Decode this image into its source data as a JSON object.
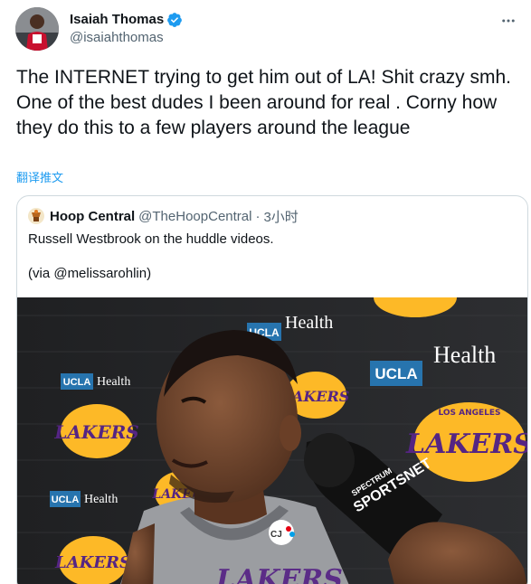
{
  "tweet": {
    "author": {
      "display_name": "Isaiah Thomas",
      "handle": "@isaiahthomas",
      "verified": true
    },
    "more_icon": "more-dots-icon",
    "text": "The INTERNET trying to get him out of LA! Shit crazy smh. One of the best dudes I been around for real . Corny how they do this to a few players around the league",
    "translate_label": "翻译推文"
  },
  "quoted_tweet": {
    "author": {
      "display_name": "Hoop Central",
      "handle": "@TheHoopCentral",
      "separator": "·",
      "time": "3小时"
    },
    "line1": "Russell Westbrook on the huddle videos.",
    "line2": "(via @melissarohlin)",
    "media": {
      "description_icon": "video-thumbnail",
      "backdrop": {
        "brand_ucla": "UCLA",
        "brand_health": "Health",
        "lakers_word": "LAKERS",
        "lakers_sub": "LOS ANGELES"
      },
      "mic_label_top": "SPECTRUM",
      "mic_label_bottom": "SPORTSNET",
      "jersey_text": "LAKERS",
      "patch_text": "CJ"
    }
  },
  "colors": {
    "link_blue": "#1d9bf0",
    "text_primary": "#0f1419",
    "text_secondary": "#536471",
    "border": "#cfd9de",
    "lakers_gold": "#fdb927",
    "lakers_purple": "#552583",
    "ucla_blue": "#2774ae"
  }
}
